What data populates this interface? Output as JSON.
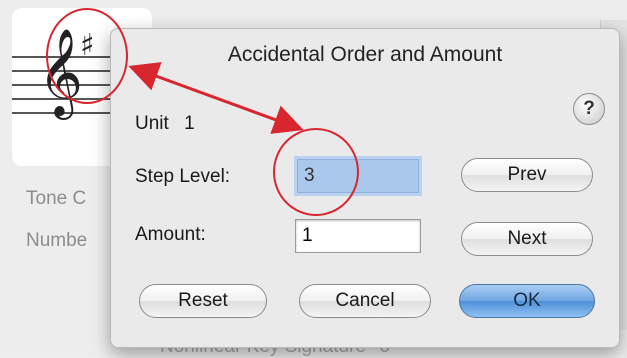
{
  "background": {
    "labels": [
      "Tone C",
      "Numbe"
    ],
    "footer_text": "Nonlinear Key Signature",
    "footer_value": "6",
    "clef_glyph": "𝄞",
    "sharp_glyph": "♯"
  },
  "dialog": {
    "title": "Accidental Order and Amount",
    "help_label": "?",
    "unit_label": "Unit",
    "unit_value": "1",
    "step_level_label": "Step Level:",
    "step_level_value": "3",
    "amount_label": "Amount:",
    "amount_value": "1",
    "prev_label": "Prev",
    "next_label": "Next",
    "reset_label": "Reset",
    "cancel_label": "Cancel",
    "ok_label": "OK"
  },
  "annotation": {
    "color": "#d8262e"
  }
}
